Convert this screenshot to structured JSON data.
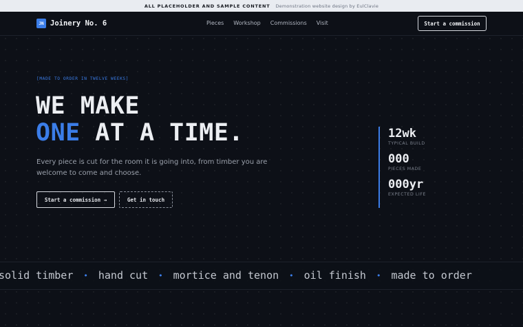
{
  "banner": {
    "strong": "ALL PLACEHOLDER AND SAMPLE CONTENT",
    "light": "Demonstration website design by EulClavie"
  },
  "nav": {
    "logo_mark": "JN",
    "logo_text": "Joinery No. 6",
    "links": [
      "Pieces",
      "Workshop",
      "Commissions",
      "Visit"
    ],
    "cta": "Start a commission"
  },
  "hero": {
    "eyebrow": "[MADE TO ORDER IN TWELVE WEEKS]",
    "line1": "WE MAKE",
    "line2_accent": "ONE",
    "line2_rest": " AT A TIME.",
    "lede": "Every piece is cut for the room it is going into, from timber you are welcome to come and choose.",
    "primary_button": "Start a commission →",
    "secondary_button": "Get in touch"
  },
  "stats": [
    {
      "value": "12wk",
      "label": "TYPICAL BUILD"
    },
    {
      "value": "000",
      "label": "PIECES MADE"
    },
    {
      "value": "000yr",
      "label": "EXPECTED LIFE"
    }
  ],
  "marquee": {
    "items": [
      "solid timber",
      "hand cut",
      "mortice and tenon",
      "oil finish",
      "made to order"
    ],
    "separator": "•"
  },
  "colors": {
    "accent": "#3b7de8",
    "background": "#0d1017",
    "banner_bg": "#e9ecf1"
  }
}
